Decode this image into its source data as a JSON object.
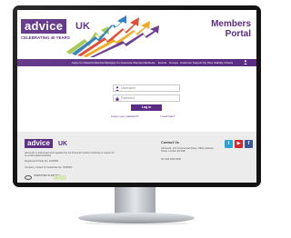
{
  "header": {
    "logo_word": "advice",
    "logo_suffix": "UK",
    "tagline": "CELEBRATING 40 YEARS",
    "portal_title": "Members Portal"
  },
  "nav": {
    "items": [
      "Apply for Network Membership",
      "Apply for Associate Membership",
      "News",
      "Events",
      "Groups",
      "Customer Support",
      "My Files",
      "Stability Criteria"
    ]
  },
  "login": {
    "username_placeholder": "Username",
    "password_placeholder": "Password",
    "login_label": "Log in",
    "forgot_label": "Forgot your password?",
    "help_label": "I need help?"
  },
  "footer": {
    "logo_word": "advice",
    "logo_suffix": "UK",
    "text1": "AdviceUK is authorised and regulated by the Financial Conduct Authority in respect of its credit-related activities",
    "text2": "Registered Charity No. 1000000",
    "text3": "Company Limited by Guarantee No. 0000000",
    "partner1_label": "INVESTORS IN PEOPLE",
    "contact_heading": "Contact Us",
    "contact_address": "AdviceUK, 101 Commercial Street, Office Address, Street, London E1 0AB",
    "contact_tel": "Tel: 020 0000 0000",
    "social": [
      "t",
      "▶",
      "f"
    ]
  },
  "colors": {
    "brand_purple": "#5b2d82",
    "twitter": "#2aa3d8",
    "youtube": "#d3252a",
    "facebook": "#3b5998"
  }
}
